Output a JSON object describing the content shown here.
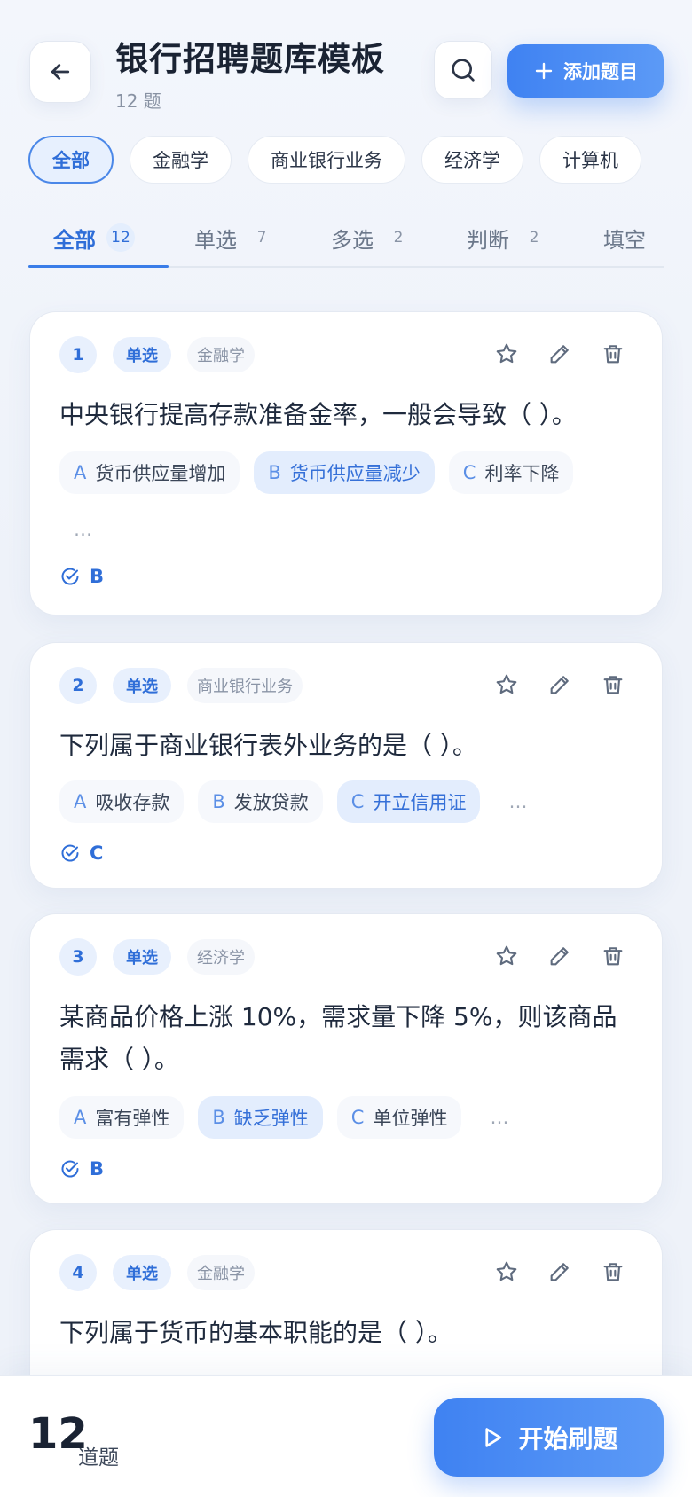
{
  "header": {
    "title": "银行招聘题库模板",
    "subtitle": "12 题",
    "add_label": "添加题目"
  },
  "categories": [
    "全部",
    "金融学",
    "商业银行业务",
    "经济学",
    "计算机"
  ],
  "tabs": [
    {
      "label": "全部",
      "count": "12"
    },
    {
      "label": "单选",
      "count": "7"
    },
    {
      "label": "多选",
      "count": "2"
    },
    {
      "label": "判断",
      "count": "2"
    },
    {
      "label": "填空",
      "count": ""
    }
  ],
  "questions": [
    {
      "num": "1",
      "type": "单选",
      "category": "金融学",
      "text": "中央银行提高存款准备金率，一般会导致（ ）。",
      "options": [
        {
          "letter": "A",
          "text": "货币供应量增加"
        },
        {
          "letter": "B",
          "text": "货币供应量减少"
        },
        {
          "letter": "C",
          "text": "利率下降"
        }
      ],
      "more": "…",
      "answer": "B"
    },
    {
      "num": "2",
      "type": "单选",
      "category": "商业银行业务",
      "text": "下列属于商业银行表外业务的是（ ）。",
      "options": [
        {
          "letter": "A",
          "text": "吸收存款"
        },
        {
          "letter": "B",
          "text": "发放贷款"
        },
        {
          "letter": "C",
          "text": "开立信用证"
        }
      ],
      "more": "…",
      "answer": "C"
    },
    {
      "num": "3",
      "type": "单选",
      "category": "经济学",
      "text": "某商品价格上涨 10%，需求量下降 5%，则该商品需求（ ）。",
      "options": [
        {
          "letter": "A",
          "text": "富有弹性"
        },
        {
          "letter": "B",
          "text": "缺乏弹性"
        },
        {
          "letter": "C",
          "text": "单位弹性"
        }
      ],
      "more": "…",
      "answer": "B"
    },
    {
      "num": "4",
      "type": "单选",
      "category": "金融学",
      "text": "下列属于货币的基本职能的是（ ）。"
    }
  ],
  "footer": {
    "count": "12",
    "unit": "道题",
    "start_label": "开始刷题"
  },
  "colors": {
    "accent": "#3f82f2",
    "accent_light": "#e8f0fd",
    "text": "#1f2a3d",
    "muted": "#8a94a6"
  }
}
